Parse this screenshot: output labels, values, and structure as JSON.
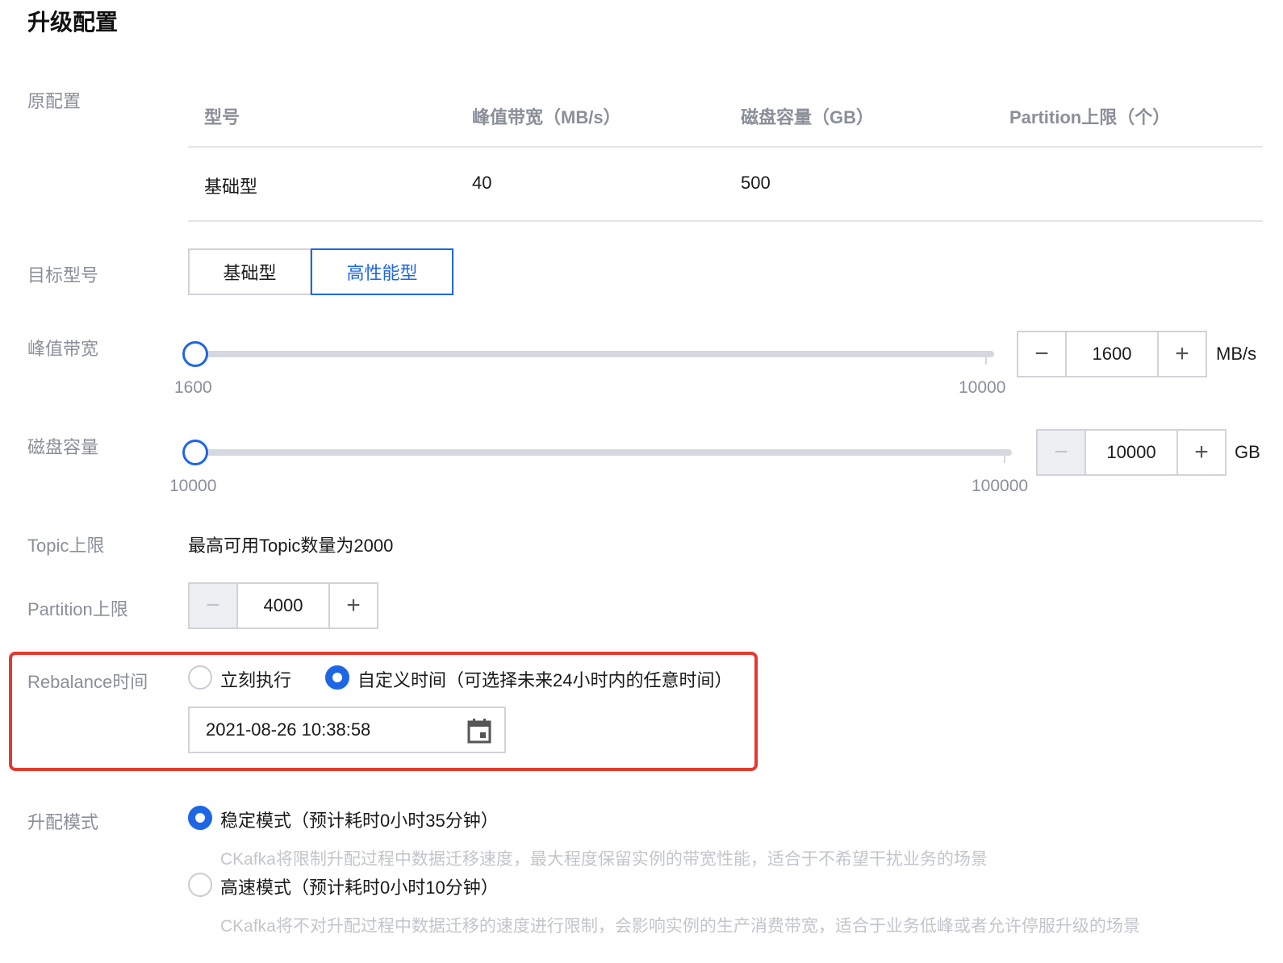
{
  "page": {
    "title": "升级配置"
  },
  "original_config": {
    "label": "原配置",
    "columns": [
      "型号",
      "峰值带宽（MB/s）",
      "磁盘容量（GB）",
      "Partition上限（个）"
    ],
    "row": [
      "基础型",
      "40",
      "500",
      ""
    ]
  },
  "target_model": {
    "label": "目标型号",
    "options": [
      "基础型",
      "高性能型"
    ],
    "selected": "高性能型"
  },
  "bandwidth": {
    "label": "峰值带宽",
    "min_label": "1600",
    "max_label": "10000",
    "min": 1600,
    "max": 10000,
    "value": 1600,
    "input_value": "1600",
    "unit": "MB/s",
    "minus": "−",
    "plus": "+"
  },
  "disk": {
    "label": "磁盘容量",
    "min_label": "10000",
    "max_label": "100000",
    "min": 10000,
    "max": 100000,
    "value": 10000,
    "input_value": "10000",
    "unit": "GB",
    "minus": "−",
    "plus": "+"
  },
  "topic": {
    "label": "Topic上限",
    "text": "最高可用Topic数量为2000"
  },
  "partition": {
    "label": "Partition上限",
    "input_value": "4000",
    "minus": "−",
    "plus": "+"
  },
  "rebalance": {
    "label": "Rebalance时间",
    "options": [
      "立刻执行",
      "自定义时间（可选择未来24小时内的任意时间）"
    ],
    "selected_index": 1,
    "datetime": "2021-08-26 10:38:58"
  },
  "upgrade_mode": {
    "label": "升配模式",
    "selected_index": 0,
    "options": [
      {
        "title": "稳定模式（预计耗时0小时35分钟）",
        "desc": "CKafka将限制升配过程中数据迁移速度，最大程度保留实例的带宽性能，适合于不希望干扰业务的场景"
      },
      {
        "title": "高速模式（预计耗时0小时10分钟）",
        "desc": "CKafka将不对升配过程中数据迁移的速度进行限制，会影响实例的生产消费带宽，适合于业务低峰或者允许停服升级的场景"
      }
    ]
  },
  "icons": {
    "calendar": "calendar-icon"
  },
  "colors": {
    "accent": "#1f66e5",
    "highlight": "#e23a2e",
    "muted": "#8a8f99"
  }
}
